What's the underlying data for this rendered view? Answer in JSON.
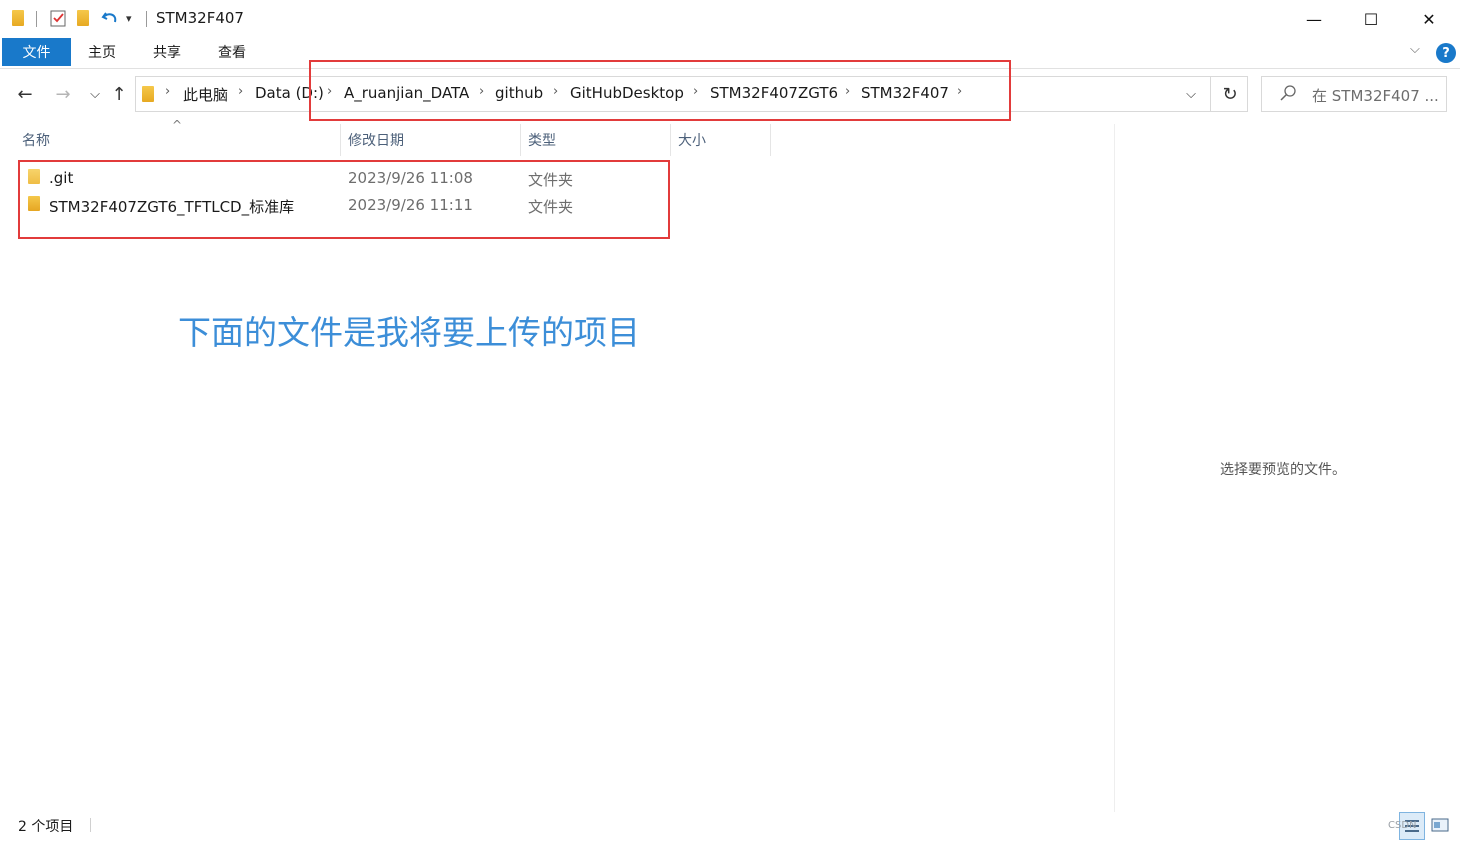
{
  "window": {
    "title": "STM32F407",
    "minimize_glyph": "—",
    "maximize_glyph": "☐",
    "close_glyph": "✕",
    "quick_access_dropdown": "▾"
  },
  "ribbon": {
    "tabs": [
      "文件",
      "主页",
      "共享",
      "查看"
    ],
    "help_glyph": "?",
    "expand_glyph": "⌵"
  },
  "nav": {
    "back_glyph": "←",
    "forward_glyph": "→",
    "recent_glyph": "⌵",
    "up_glyph": "↑",
    "breadcrumb": [
      "此电脑",
      "Data (D:)",
      "A_ruanjian_DATA",
      "github",
      "GitHubDesktop",
      "STM32F407ZGT6",
      "STM32F407"
    ],
    "separator_glyph": "›",
    "dropdown_glyph": "⌵",
    "refresh_glyph": "↻",
    "search_placeholder": "在 STM32F407 ..."
  },
  "columns": {
    "name": "名称",
    "date": "修改日期",
    "type": "类型",
    "size": "大小",
    "sort_glyph": "^"
  },
  "files": [
    {
      "name": ".git",
      "date": "2023/9/26 11:08",
      "type": "文件夹",
      "icon": "folder-icon"
    },
    {
      "name": "STM32F407ZGT6_TFTLCD_标准库",
      "date": "2023/9/26 11:11",
      "type": "文件夹",
      "icon": "folder-icon"
    }
  ],
  "annotation": "下面的文件是我将要上传的项目",
  "preview": {
    "empty_text": "选择要预览的文件。"
  },
  "status": {
    "item_count": "2 个项目"
  },
  "watermark": "CSDN",
  "colors": {
    "accent": "#1979ca",
    "highlight_box": "#e23b3b",
    "annotation": "#3c8ed8",
    "folder": "#f0b63a"
  }
}
